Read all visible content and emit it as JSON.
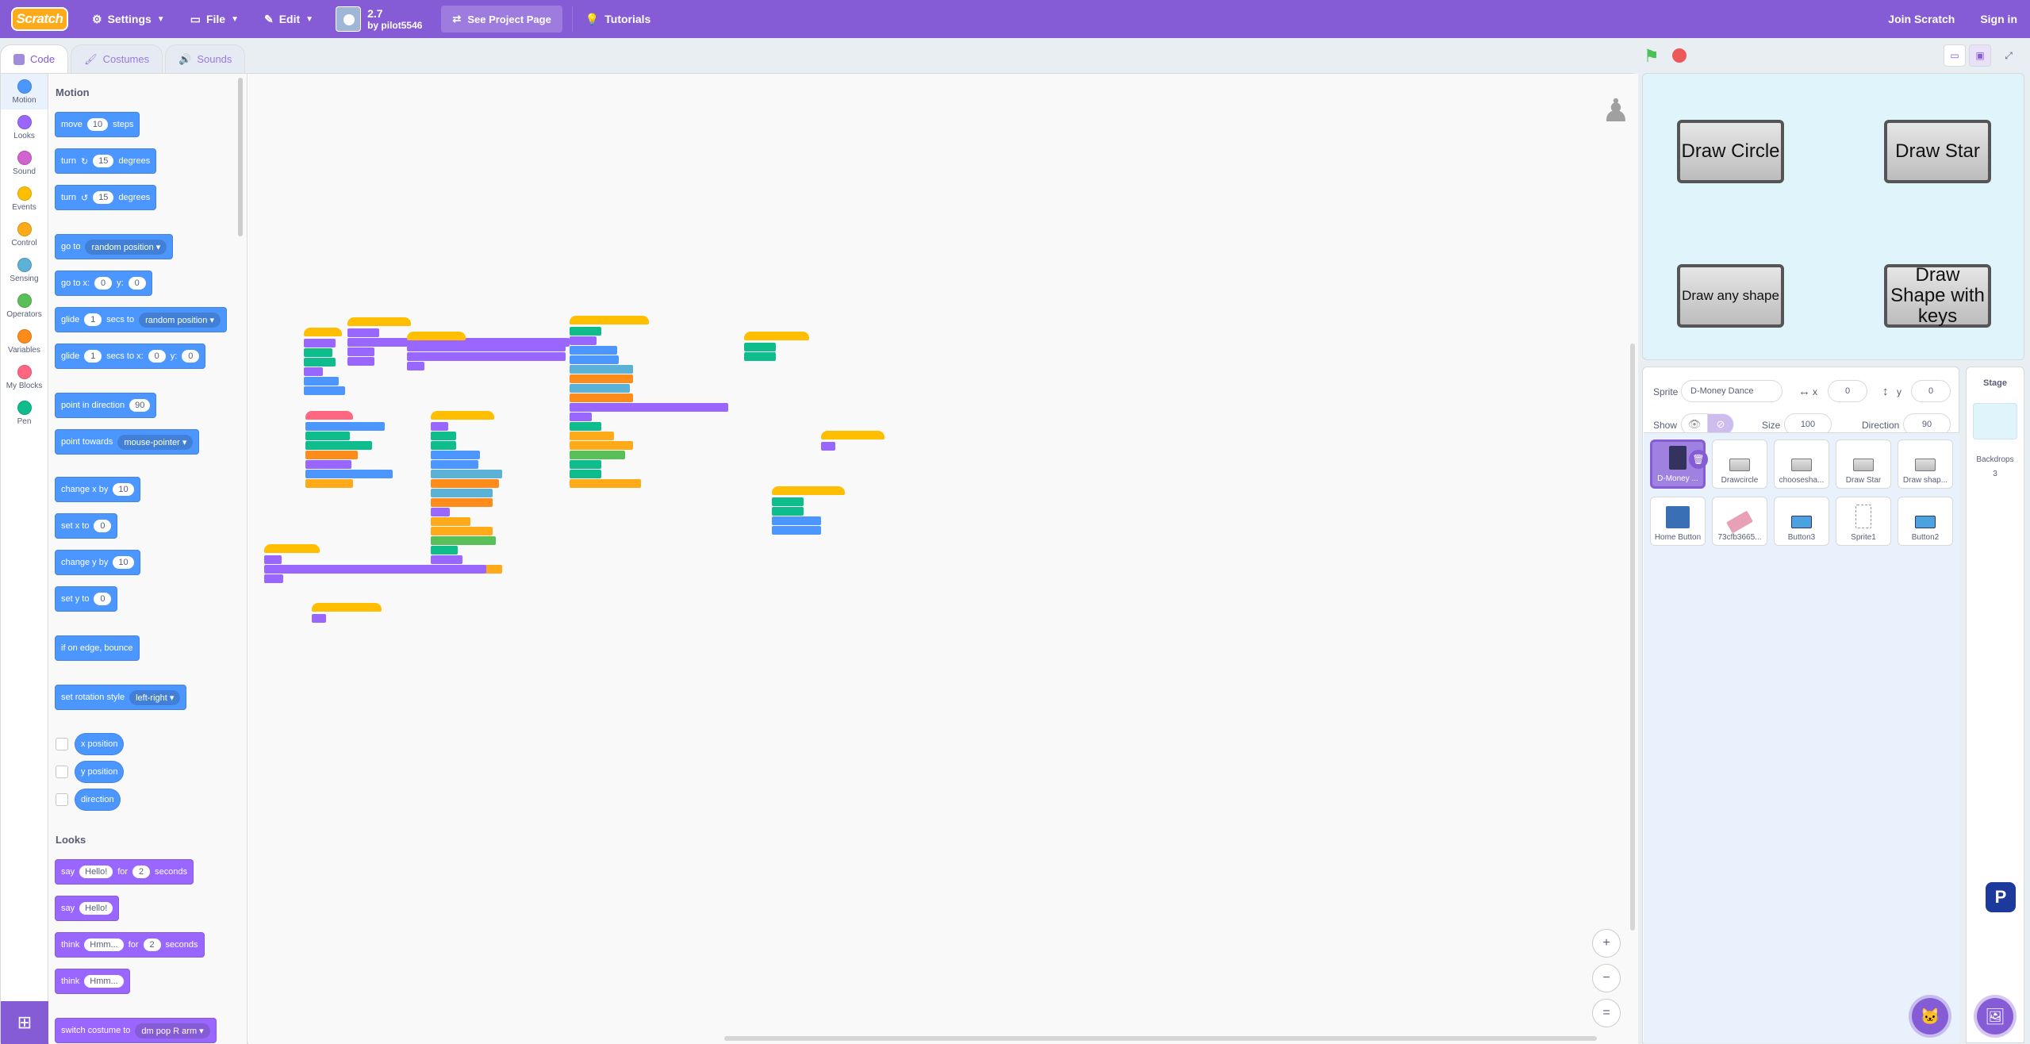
{
  "menubar": {
    "logo": "Scratch",
    "settings": "Settings",
    "file": "File",
    "edit": "Edit",
    "project_title": "2.7",
    "project_author": "by pilot5546",
    "see_project_page": "See Project Page",
    "tutorials": "Tutorials",
    "join": "Join Scratch",
    "signin": "Sign in"
  },
  "tabs": {
    "code": "Code",
    "costumes": "Costumes",
    "sounds": "Sounds"
  },
  "categories": [
    {
      "label": "Motion",
      "color": "#4c97ff"
    },
    {
      "label": "Looks",
      "color": "#9966ff"
    },
    {
      "label": "Sound",
      "color": "#cf63cf"
    },
    {
      "label": "Events",
      "color": "#ffbf00"
    },
    {
      "label": "Control",
      "color": "#ffab19"
    },
    {
      "label": "Sensing",
      "color": "#5cb1d6"
    },
    {
      "label": "Operators",
      "color": "#59c059"
    },
    {
      "label": "Variables",
      "color": "#ff8c1a"
    },
    {
      "label": "My Blocks",
      "color": "#ff6680"
    },
    {
      "label": "Pen",
      "color": "#0fbd8c"
    }
  ],
  "palette": {
    "motion_heading": "Motion",
    "looks_heading": "Looks",
    "move": {
      "a": "move",
      "v": "10",
      "b": "steps"
    },
    "turn_cw": {
      "a": "turn",
      "icon": "↻",
      "v": "15",
      "b": "degrees"
    },
    "turn_ccw": {
      "a": "turn",
      "icon": "↺",
      "v": "15",
      "b": "degrees"
    },
    "goto": {
      "a": "go to",
      "d": "random position"
    },
    "gotoxy": {
      "a": "go to x:",
      "x": "0",
      "b": "y:",
      "y": "0"
    },
    "glide": {
      "a": "glide",
      "v": "1",
      "b": "secs to",
      "d": "random position"
    },
    "glidexy": {
      "a": "glide",
      "v": "1",
      "b": "secs to x:",
      "x": "0",
      "c": "y:",
      "y": "0"
    },
    "point_dir": {
      "a": "point in direction",
      "v": "90"
    },
    "point_towards": {
      "a": "point towards",
      "d": "mouse-pointer"
    },
    "change_x": {
      "a": "change x by",
      "v": "10"
    },
    "set_x": {
      "a": "set x to",
      "v": "0"
    },
    "change_y": {
      "a": "change y by",
      "v": "10"
    },
    "set_y": {
      "a": "set y to",
      "v": "0"
    },
    "bounce": "if on edge, bounce",
    "rot_style": {
      "a": "set rotation style",
      "d": "left-right"
    },
    "x_pos": "x position",
    "y_pos": "y position",
    "direction": "direction",
    "say_for": {
      "a": "say",
      "v": "Hello!",
      "b": "for",
      "n": "2",
      "c": "seconds"
    },
    "say": {
      "a": "say",
      "v": "Hello!"
    },
    "think_for": {
      "a": "think",
      "v": "Hmm...",
      "b": "for",
      "n": "2",
      "c": "seconds"
    },
    "think": {
      "a": "think",
      "v": "Hmm..."
    },
    "switch_costume": {
      "a": "switch costume to",
      "d": "dm pop R arm"
    }
  },
  "stage": {
    "buttons": [
      "Draw Circle",
      "Draw Star",
      "Draw any shape",
      "Draw Shape with keys"
    ]
  },
  "sprite_info": {
    "sprite_label": "Sprite",
    "sprite_name": "D-Money Dance",
    "x_label": "x",
    "x_value": "0",
    "y_label": "y",
    "y_value": "0",
    "show_label": "Show",
    "size_label": "Size",
    "size_value": "100",
    "direction_label": "Direction",
    "direction_value": "90"
  },
  "sprites": [
    "D-Money ...",
    "Drawcircle",
    "choosesha...",
    "Draw Star",
    "Draw shap...",
    "Home Button",
    "73cfb3665...",
    "Button3",
    "Sprite1",
    "Button2"
  ],
  "stage_pane": {
    "title": "Stage",
    "backdrops_label": "Backdrops",
    "backdrops_count": "3"
  },
  "zoom": {
    "in": "+",
    "out": "−",
    "reset": "="
  }
}
